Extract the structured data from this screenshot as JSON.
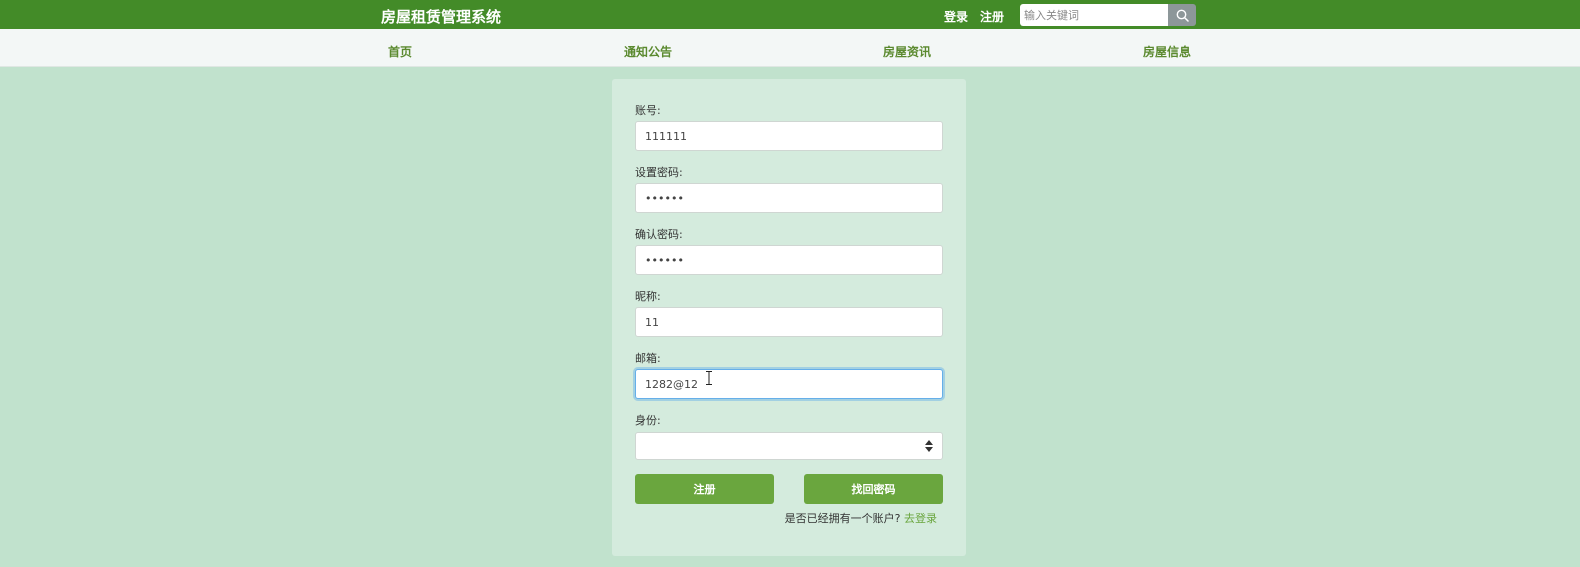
{
  "header": {
    "brand": "房屋租赁管理系统",
    "login_label": "登录",
    "register_label": "注册",
    "search_placeholder": "输入关键词",
    "bg_color": "#438b28"
  },
  "nav": {
    "items": [
      {
        "label": "首页"
      },
      {
        "label": "通知公告"
      },
      {
        "label": "房屋资讯"
      },
      {
        "label": "房屋信息"
      }
    ]
  },
  "form": {
    "account_label": "账号:",
    "account_value": "111111",
    "password_label": "设置密码:",
    "password_value": "••••••",
    "confirm_label": "确认密码:",
    "confirm_value": "••••••",
    "nickname_label": "昵称:",
    "nickname_value": "11",
    "email_label": "邮箱:",
    "email_value": "1282@12",
    "identity_label": "身份:",
    "identity_value": "",
    "register_button": "注册",
    "recover_button": "找回密码",
    "have_account_text": "是否已经拥有一个账户?",
    "go_login_link": "去登录"
  },
  "icons": {
    "search": "search-icon",
    "select_arrows": "updown-arrows-icon",
    "text_cursor": "text-cursor-icon"
  },
  "colors": {
    "page_bg": "#c1e2cd",
    "panel_bg": "#d4ebdd",
    "button": "#6aa63e",
    "nav_text": "#5b8a2f"
  }
}
